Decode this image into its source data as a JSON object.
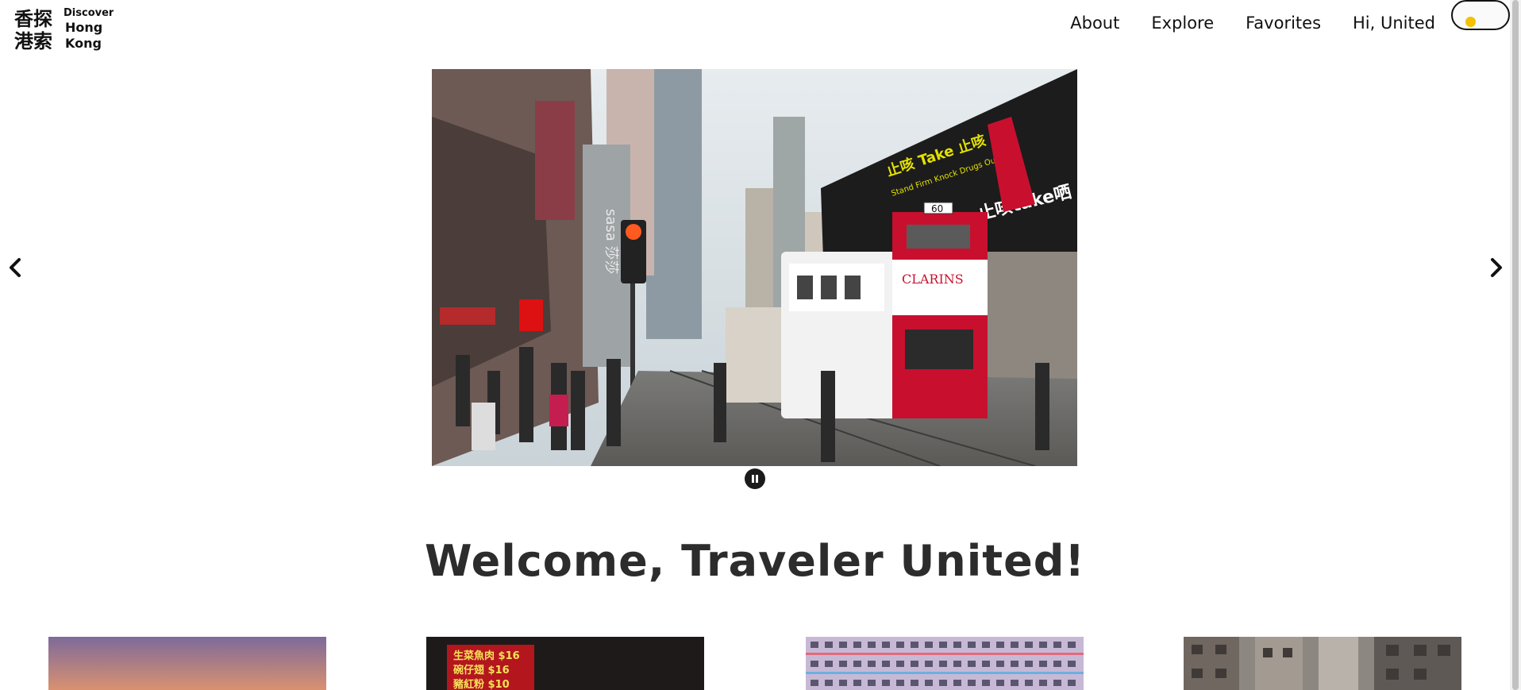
{
  "logo": {
    "chinese_line1": "香探",
    "chinese_line2": "港索",
    "english_line1": "Discover",
    "english_line2": "Hong",
    "english_line3": "Kong"
  },
  "nav": {
    "items": [
      {
        "label": "About"
      },
      {
        "label": "Explore"
      },
      {
        "label": "Favorites"
      },
      {
        "label": "Hi, United"
      }
    ]
  },
  "theme_toggle": {
    "state": "light",
    "knob_color": "#f2c200"
  },
  "carousel": {
    "prev_icon": "chevron-left-icon",
    "next_icon": "chevron-right-icon",
    "pause_icon": "pause-icon",
    "slide": {
      "billboard_top": "止咳 Take 止咳",
      "billboard_sub": "Stand Firm Knock Drugs Out",
      "billboard_brand": "止咳take哂",
      "mall_sign": "sasa 莎莎",
      "tram_ad": "CLARINS",
      "tram_route": "60"
    }
  },
  "welcome": "Welcome, Traveler United!",
  "cards": [
    {
      "id": "sunset"
    },
    {
      "id": "food-stall",
      "sign_lines": [
        "生菜魚肉 $16",
        "碗仔翅 $16",
        "豬紅粉 $10"
      ]
    },
    {
      "id": "choi-hung-estate"
    },
    {
      "id": "old-buildings"
    }
  ],
  "colors": {
    "accent": "#f2c200",
    "text": "#111111",
    "heading": "#2c2c2c",
    "tram_red": "#c8102e"
  }
}
